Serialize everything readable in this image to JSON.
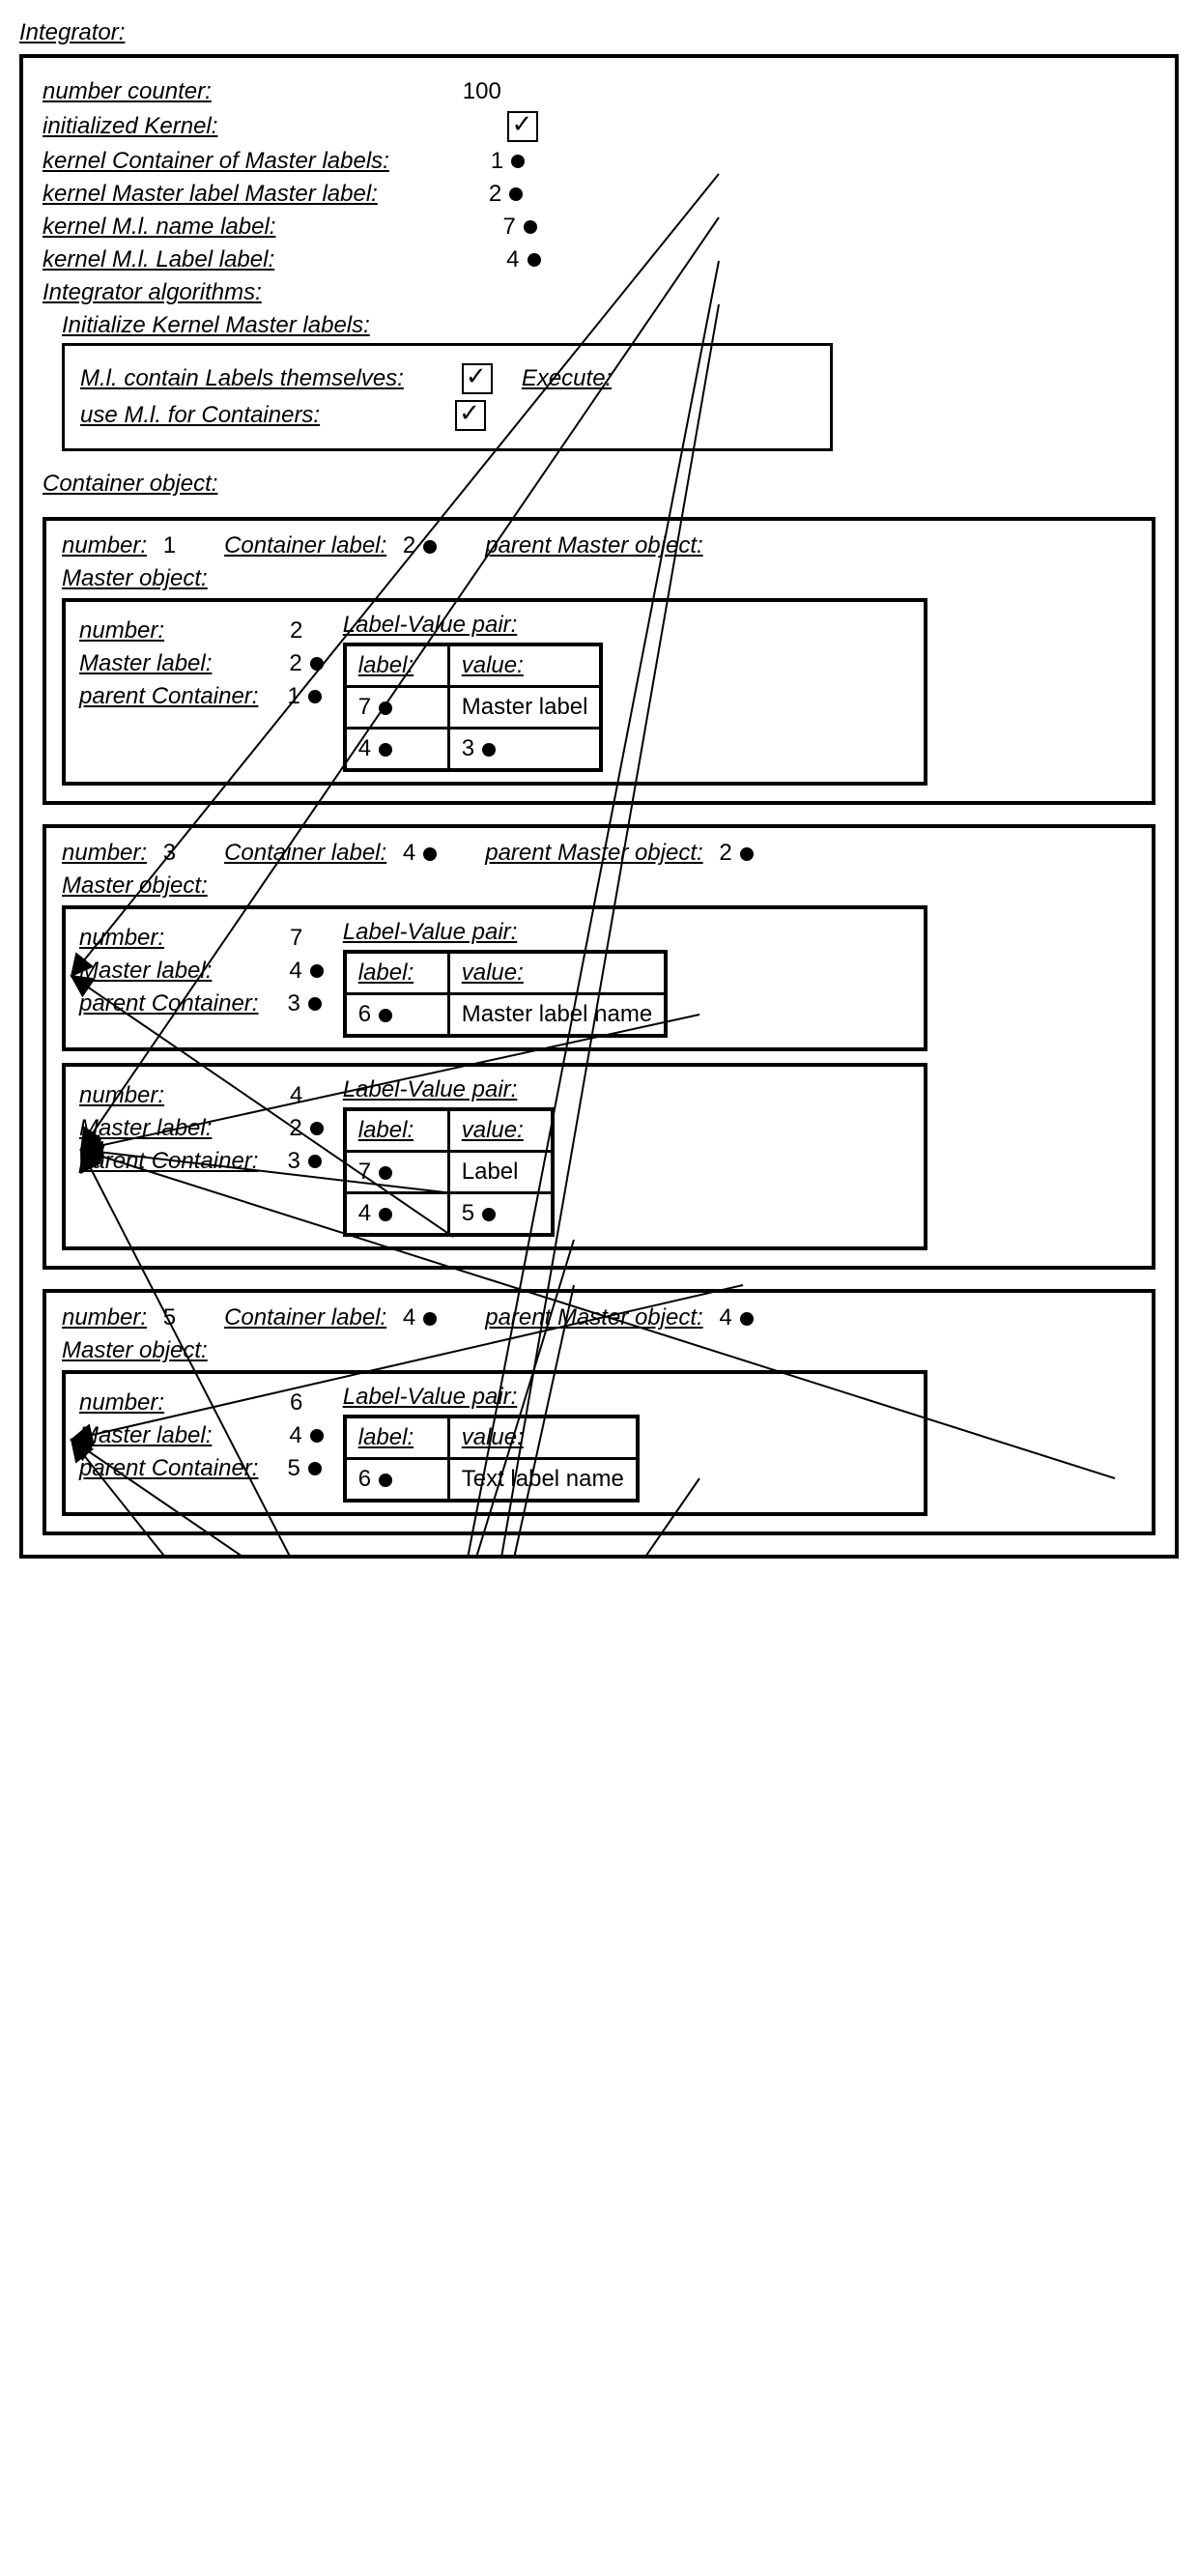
{
  "title": "Integrator:",
  "top": {
    "number_counter_label": "number counter:",
    "number_counter_value": "100",
    "initialized_label": "initialized Kernel:",
    "row3_label": "kernel Container of Master labels:",
    "row3_val": "1",
    "row4_label": "kernel Master label Master label:",
    "row4_val": "2",
    "row5_label": "kernel M.l. name label:",
    "row5_val": "7",
    "row6_label": "kernel M.l. Label label:",
    "row6_val": "4",
    "algo_label": "Integrator algorithms:"
  },
  "init_box": {
    "title": "Initialize Kernel Master labels:",
    "r1_label": "M.l. contain Labels themselves:",
    "r1_exec": "Execute:",
    "r2_label": "use M.l. for Containers:"
  },
  "c1": {
    "header": "Container object:",
    "number_l": "number:",
    "number_v": "1",
    "clabel_l": "Container label:",
    "clabel_v": "2",
    "parent_l": "parent Master object:",
    "m_header": "Master object:",
    "m": {
      "number_l": "number:",
      "number_v": "2",
      "ml_l": "Master label:",
      "ml_v": "2",
      "pc_l": "parent Container:",
      "pc_v": "1",
      "lv_title": "Label-Value pair:",
      "hl": "label:",
      "hv": "value:",
      "r1_l": "7",
      "r1_v": "Master label",
      "r2_l": "4",
      "r2_v": "3"
    }
  },
  "c2": {
    "number_l": "number:",
    "number_v": "3",
    "clabel_l": "Container label:",
    "clabel_v": "4",
    "parent_l": "parent Master object:",
    "parent_v": "2",
    "m_header": "Master object:",
    "m1": {
      "number_l": "number:",
      "number_v": "7",
      "ml_l": "Master label:",
      "ml_v": "4",
      "pc_l": "parent Container:",
      "pc_v": "3",
      "lv_title": "Label-Value pair:",
      "hl": "label:",
      "hv": "value:",
      "r1_l": "6",
      "r1_v": "Master label name"
    },
    "m2": {
      "number_l": "number:",
      "number_v": "4",
      "ml_l": "Master label:",
      "ml_v": "2",
      "pc_l": "parent Container:",
      "pc_v": "3",
      "lv_title": "Label-Value pair:",
      "hl": "label:",
      "hv": "value:",
      "r1_l": "7",
      "r1_v": "Label",
      "r2_l": "4",
      "r2_v": "5"
    }
  },
  "c3": {
    "number_l": "number:",
    "number_v": "5",
    "clabel_l": "Container label:",
    "clabel_v": "4",
    "parent_l": "parent Master object:",
    "parent_v": "4",
    "m_header": "Master object:",
    "m": {
      "number_l": "number:",
      "number_v": "6",
      "ml_l": "Master label:",
      "ml_v": "4",
      "pc_l": "parent Container:",
      "pc_v": "5",
      "lv_title": "Label-Value pair:",
      "hl": "label:",
      "hv": "value:",
      "r1_l": "6",
      "r1_v": "Text label name"
    }
  }
}
